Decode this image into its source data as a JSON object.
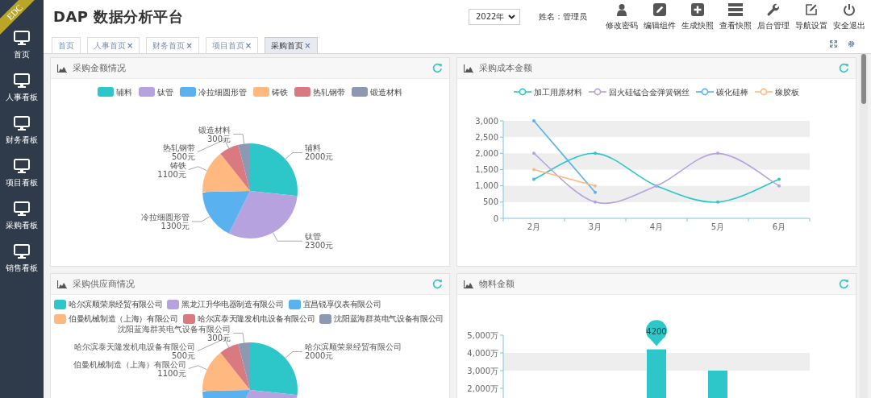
{
  "sidebar": {
    "ribbon": "EDC",
    "items": [
      {
        "label": "首页"
      },
      {
        "label": "人事看板"
      },
      {
        "label": "财务看板"
      },
      {
        "label": "项目看板"
      },
      {
        "label": "采购看板"
      },
      {
        "label": "销售看板"
      }
    ]
  },
  "header": {
    "title": "DAP 数据分析平台",
    "year": "2022年",
    "user": "姓名：管理员",
    "actions": [
      {
        "label": "修改密码"
      },
      {
        "label": "编辑组件"
      },
      {
        "label": "生成快照"
      },
      {
        "label": "查看快照"
      },
      {
        "label": "后台管理"
      },
      {
        "label": "导航设置"
      },
      {
        "label": "安全退出"
      }
    ]
  },
  "tabs": [
    {
      "label": "首页",
      "selected": false
    },
    {
      "label": "人事首页",
      "close": "×",
      "selected": false
    },
    {
      "label": "财务首页",
      "close": "×",
      "selected": false
    },
    {
      "label": "项目首页",
      "close": "×",
      "selected": false
    },
    {
      "label": "采购首页",
      "close": "×",
      "selected": true
    }
  ],
  "panels": [
    {
      "title": "采购金额情况",
      "chart_data": {
        "type": "pie",
        "categories": [
          "辅料",
          "钛管",
          "冷拉细圆形管",
          "铸铁",
          "热轧钢带",
          "锻造材料"
        ],
        "values": [
          2000,
          2300,
          1300,
          1100,
          500,
          300
        ],
        "value_labels": [
          "2000元",
          "2300元",
          "1300元",
          "1100元",
          "500元",
          "300元"
        ]
      }
    },
    {
      "title": "采购成本金额",
      "chart_data": {
        "type": "line",
        "categories": [
          "2月",
          "3月",
          "4月",
          "5月",
          "6月"
        ],
        "ylim": [
          0,
          3000
        ],
        "yticks": [
          {
            "value": 0,
            "label": "0"
          },
          {
            "value": 500,
            "label": "500"
          },
          {
            "value": 1000,
            "label": "1,000"
          },
          {
            "value": 1500,
            "label": "1,500"
          },
          {
            "value": 2000,
            "label": "2,000"
          },
          {
            "value": 2500,
            "label": "2,500"
          },
          {
            "value": 3000,
            "label": "3,000"
          }
        ],
        "series": [
          {
            "name": "加工用原材料",
            "color": "#2ec7c9",
            "values": [
              1200,
              2000,
              1000,
              500,
              1200
            ]
          },
          {
            "name": "回火硅锰合金弹簧钢丝",
            "color": "#b6a2de",
            "values": [
              2000,
              500,
              1000,
              2000,
              1000
            ]
          },
          {
            "name": "碳化硅棒",
            "color": "#5ab1ef",
            "values": [
              3000,
              800,
              null,
              null,
              null
            ]
          },
          {
            "name": "橡胶板",
            "color": "#ffb980",
            "values": [
              1500,
              1000,
              null,
              null,
              null
            ]
          }
        ]
      }
    },
    {
      "title": "采购供应商情况",
      "chart_data": {
        "type": "pie",
        "categories": [
          "哈尔滨顺荣泉经贸有限公司",
          "黑龙江升华电器制造有限公司",
          "宜昌锐享仪表有限公司",
          "伯曼机械制造（上海）有限公司",
          "哈尔滨泰天隆发机电设备有限公司",
          "沈阳蓝海群英电气设备有限公司"
        ],
        "values": [
          2000,
          2300,
          1300,
          1100,
          500,
          300
        ],
        "value_labels": [
          "2000元",
          null,
          null,
          "1100元",
          "500元",
          "300元"
        ]
      }
    },
    {
      "title": "物料金额",
      "chart_data": {
        "type": "bar",
        "ylim": [
          0,
          5000
        ],
        "yticks": [
          {
            "value": 2000,
            "label": "2,000万"
          },
          {
            "value": 3000,
            "label": "3,000万"
          },
          {
            "value": 4000,
            "label": "4,000万"
          },
          {
            "value": 5000,
            "label": "5,000万"
          }
        ],
        "values": [
          null,
          null,
          4200,
          3000,
          null
        ],
        "value_labels": [
          null,
          null,
          "4200",
          null,
          null
        ]
      }
    }
  ]
}
